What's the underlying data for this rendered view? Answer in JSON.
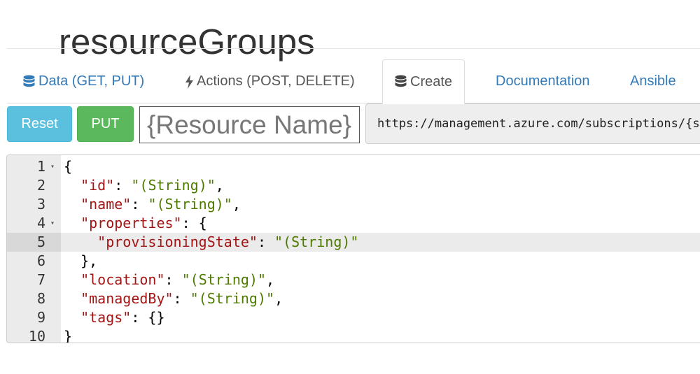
{
  "page": {
    "title": "resourceGroups"
  },
  "tabs": [
    {
      "label": "Data (GET, PUT)",
      "icon": "database-icon"
    },
    {
      "label": "Actions (POST, DELETE)",
      "icon": "bolt-icon"
    },
    {
      "label": "Create",
      "icon": "database-icon",
      "active": true
    },
    {
      "label": "Documentation"
    },
    {
      "label": "Ansible"
    }
  ],
  "toolbar": {
    "reset_label": "Reset",
    "put_label": "PUT",
    "resource_name_placeholder": "{Resource Name}",
    "url": "https://management.azure.com/subscriptions/{subscriptionId}/resourcegroups/{resourceGroupName}"
  },
  "editor": {
    "active_line": 5,
    "lines": [
      {
        "num": "1",
        "fold": true,
        "tokens": [
          [
            "p",
            "{"
          ]
        ]
      },
      {
        "num": "2",
        "fold": false,
        "tokens": [
          [
            "p",
            "  "
          ],
          [
            "k",
            "\"id\""
          ],
          [
            "p",
            ": "
          ],
          [
            "s",
            "\"(String)\""
          ],
          [
            "p",
            ","
          ]
        ]
      },
      {
        "num": "3",
        "fold": false,
        "tokens": [
          [
            "p",
            "  "
          ],
          [
            "k",
            "\"name\""
          ],
          [
            "p",
            ": "
          ],
          [
            "s",
            "\"(String)\""
          ],
          [
            "p",
            ","
          ]
        ]
      },
      {
        "num": "4",
        "fold": true,
        "tokens": [
          [
            "p",
            "  "
          ],
          [
            "k",
            "\"properties\""
          ],
          [
            "p",
            ": {"
          ]
        ]
      },
      {
        "num": "5",
        "fold": false,
        "tokens": [
          [
            "p",
            "    "
          ],
          [
            "k",
            "\"provisioningState\""
          ],
          [
            "p",
            ": "
          ],
          [
            "s",
            "\"(String)\""
          ]
        ]
      },
      {
        "num": "6",
        "fold": false,
        "tokens": [
          [
            "p",
            "  },"
          ]
        ]
      },
      {
        "num": "7",
        "fold": false,
        "tokens": [
          [
            "p",
            "  "
          ],
          [
            "k",
            "\"location\""
          ],
          [
            "p",
            ": "
          ],
          [
            "s",
            "\"(String)\""
          ],
          [
            "p",
            ","
          ]
        ]
      },
      {
        "num": "8",
        "fold": false,
        "tokens": [
          [
            "p",
            "  "
          ],
          [
            "k",
            "\"managedBy\""
          ],
          [
            "p",
            ": "
          ],
          [
            "s",
            "\"(String)\""
          ],
          [
            "p",
            ","
          ]
        ]
      },
      {
        "num": "9",
        "fold": false,
        "tokens": [
          [
            "p",
            "  "
          ],
          [
            "k",
            "\"tags\""
          ],
          [
            "p",
            ": {}"
          ]
        ]
      },
      {
        "num": "10",
        "fold": false,
        "tokens": [
          [
            "p",
            "}"
          ]
        ]
      }
    ]
  },
  "colors": {
    "link": "#337ab7",
    "reset_button": "#5bc0de",
    "put_button": "#5cb85c",
    "json_key": "#a31515",
    "json_string": "#4e7a00"
  }
}
